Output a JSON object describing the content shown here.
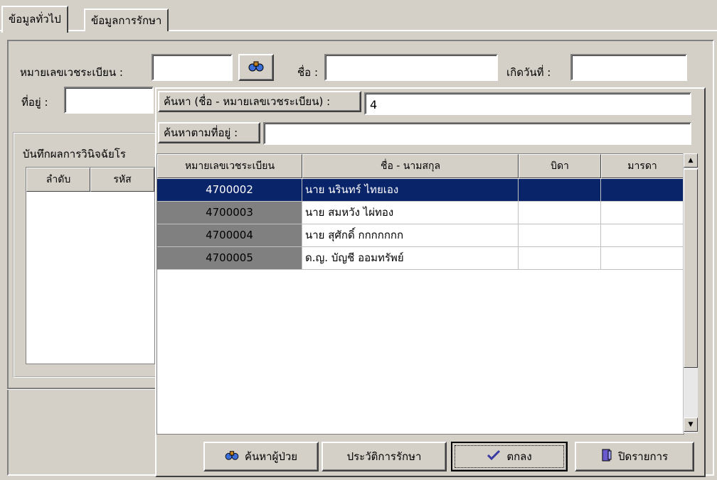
{
  "tabs": {
    "general": "ข้อมูลทั่วไป",
    "treatment": "ข้อมูลการรักษา"
  },
  "form": {
    "hn_label": "หมายเลขเวชระเบียน :",
    "name_label": "ชื่อ :",
    "birth_label": "เกิดวันที่ :",
    "address_label": "ที่อยู่ :",
    "diagnosis_group": "บันทึกผลการวินิจฉัยโร",
    "diag_col_no": "ลำดับ",
    "diag_col_code": "รหัส"
  },
  "search": {
    "query_label": "ค้นหา (ชื่อ - หมายเลขเวชระเบียน) :",
    "query_value": "4",
    "address_label": "ค้นหาตามที่อยู่ :",
    "address_value": ""
  },
  "results": {
    "columns": [
      "หมายเลขเวชระเบียน",
      "ชื่อ - นามสกุล",
      "บิดา",
      "มารดา"
    ],
    "rows": [
      {
        "hn": "4700002",
        "name": "นาย นรินทร์ ไทยเอง",
        "father": "",
        "mother": ""
      },
      {
        "hn": "4700003",
        "name": "นาย สมหวัง ไผ่ทอง",
        "father": "",
        "mother": ""
      },
      {
        "hn": "4700004",
        "name": "นาย สุศักดิ์ กกกกกกก",
        "father": "",
        "mother": ""
      },
      {
        "hn": "4700005",
        "name": "ด.ญ. บัญชี ออมทรัพย์",
        "father": "",
        "mother": ""
      }
    ],
    "selected_index": 0
  },
  "buttons": {
    "search_patient": "ค้นหาผู้ป่วย",
    "history": "ประวัติการรักษา",
    "ok": "ตกลง",
    "close": "ปิดรายการ"
  },
  "colors": {
    "selection": "#0a246a",
    "face": "#d4d0c8"
  }
}
